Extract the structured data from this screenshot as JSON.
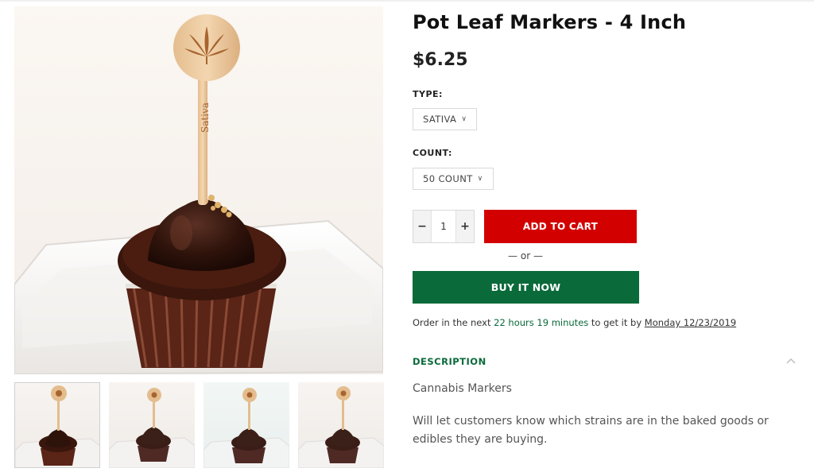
{
  "product": {
    "title": "Pot Leaf Markers - 4 Inch",
    "price": "$6.25",
    "image_alt": "Chocolate cupcake with wooden pot leaf marker labeled Sativa",
    "marker_text": "Sativa",
    "thumbnails": [
      "thumbnail-1",
      "thumbnail-2",
      "thumbnail-3",
      "thumbnail-4"
    ]
  },
  "options": {
    "type_label": "TYPE:",
    "type_value": "SATIVA",
    "count_label": "COUNT:",
    "count_value": "50 COUNT"
  },
  "quantity": {
    "minus": "−",
    "value": "1",
    "plus": "+"
  },
  "actions": {
    "add_to_cart": "ADD TO CART",
    "or": "— or —",
    "buy_now": "BUY IT NOW"
  },
  "delivery": {
    "prefix": "Order in the next ",
    "countdown": "22 hours 19 minutes",
    "middle": " to get it by ",
    "date": "Monday 12/23/2019"
  },
  "description": {
    "heading": "DESCRIPTION",
    "line1": "Cannabis Markers",
    "line2": "Will let customers know which strains are in the baked goods or edibles they are buying."
  },
  "colors": {
    "add_to_cart": "#d30000",
    "buy_now": "#0a6a3a",
    "accent_green": "#0a6a3a"
  },
  "icons": {
    "select_chevron": "chevron-down-icon",
    "description_toggle": "chevron-up-icon"
  }
}
